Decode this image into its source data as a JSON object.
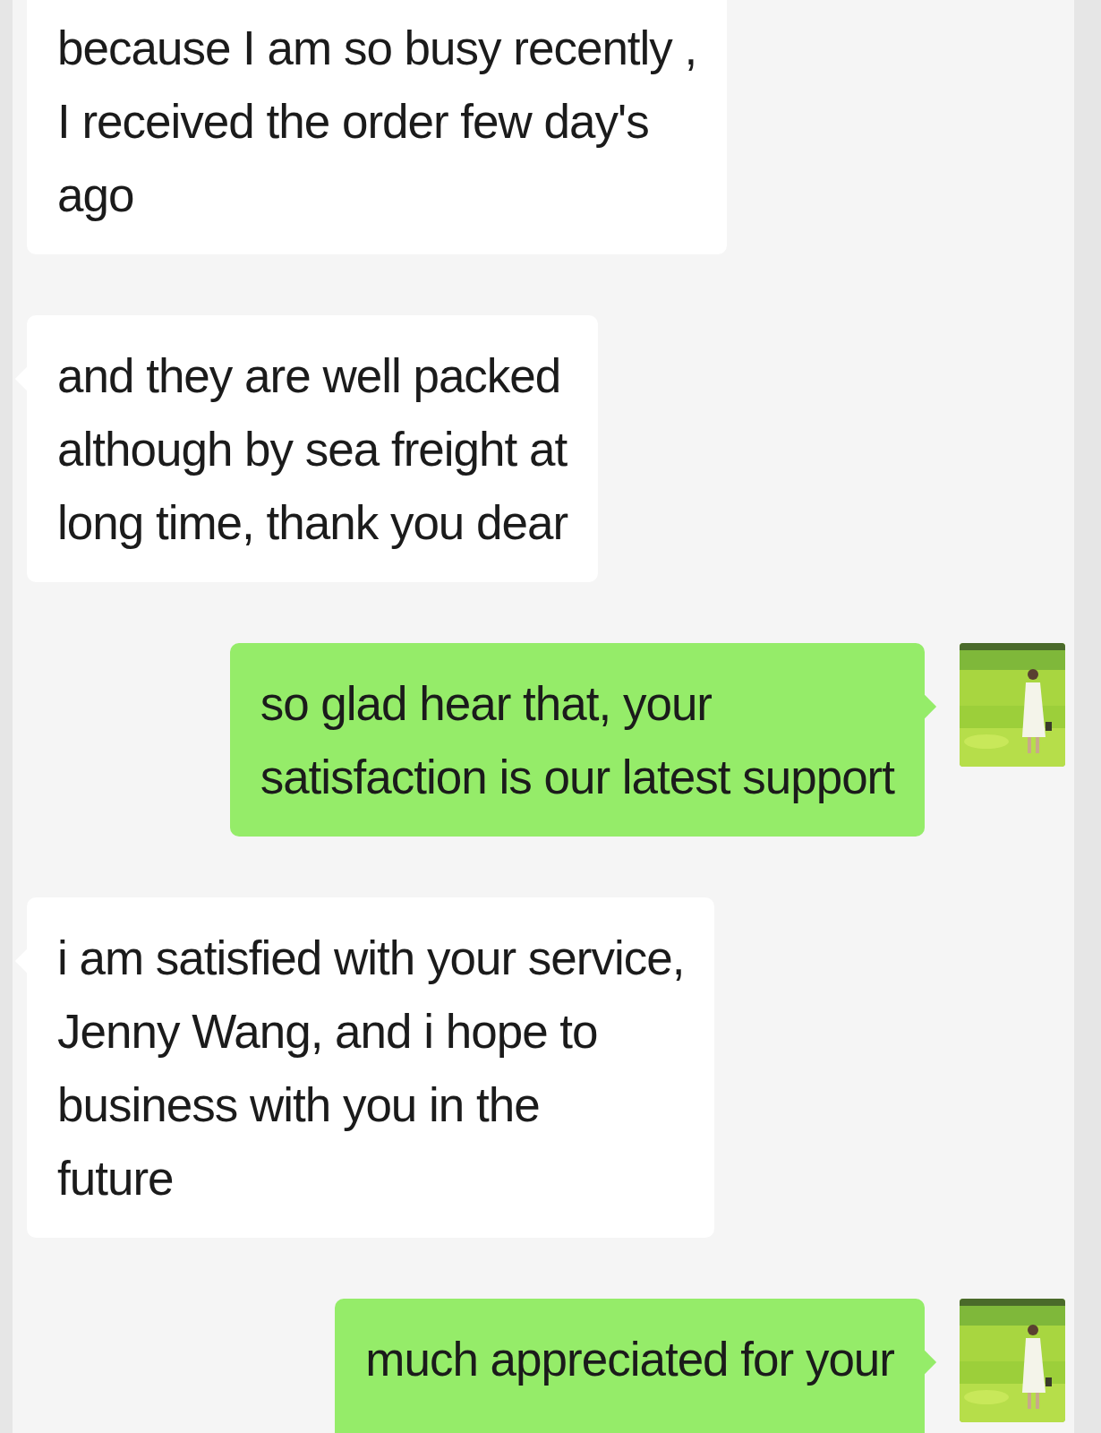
{
  "messages": [
    {
      "kind": "received",
      "text": "because  I am so busy recently ,\nI received  the order few day's\nago"
    },
    {
      "kind": "received",
      "text": "and they are well packed\nalthough  by sea freight  at\nlong time, thank you dear"
    },
    {
      "kind": "sent",
      "text": "so glad hear that,  your\nsatisfaction is our latest support"
    },
    {
      "kind": "received",
      "text": "i am satisfied  with your service,\n Jenny Wang, and i hope to\nbusiness with you  in the\nfuture"
    },
    {
      "kind": "sent",
      "text": "much appreciated for your"
    }
  ]
}
